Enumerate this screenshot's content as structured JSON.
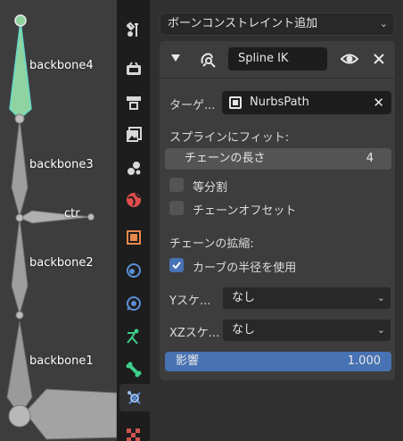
{
  "viewport": {
    "bones": [
      {
        "label": "backbone4"
      },
      {
        "label": "backbone3"
      },
      {
        "label": "ctr"
      },
      {
        "label": "backbone2"
      },
      {
        "label": "backbone1"
      }
    ]
  },
  "tabs": [
    {
      "icon": "tool-icon"
    },
    {
      "icon": "render-icon"
    },
    {
      "icon": "output-icon"
    },
    {
      "icon": "view-layer-icon"
    },
    {
      "icon": "scene-icon"
    },
    {
      "icon": "world-icon"
    },
    {
      "icon": "object-icon"
    },
    {
      "icon": "modifier-icon"
    },
    {
      "icon": "physics-icon"
    },
    {
      "icon": "object-data-armature-icon"
    },
    {
      "icon": "bone-icon"
    },
    {
      "icon": "bone-constraint-icon"
    },
    {
      "icon": "texture-icon"
    }
  ],
  "panel": {
    "add_constraint_label": "ボーンコンストレイント追加",
    "constraint": {
      "name": "Spline IK",
      "target_label": "ターゲ...",
      "target_value": "NurbsPath",
      "fit_section_label": "スプラインにフィット:",
      "chain_length_label": "チェーンの長さ",
      "chain_length_value": "4",
      "even_divisions_label": "等分割",
      "even_divisions_checked": false,
      "chain_offset_label": "チェーンオフセット",
      "chain_offset_checked": false,
      "chain_scaling_section_label": "チェーンの拡縮:",
      "use_curve_radius_label": "カーブの半径を使用",
      "use_curve_radius_checked": true,
      "y_scale_label": "Yスケ...",
      "y_scale_value": "なし",
      "xz_scale_label": "XZスケ...",
      "xz_scale_value": "なし",
      "influence_label": "影響",
      "influence_value": "1.000"
    }
  },
  "colors": {
    "accent": "#4772b3",
    "selected_bone": "#8fd4a0",
    "bone_outline_selected": "#63d8c9"
  }
}
